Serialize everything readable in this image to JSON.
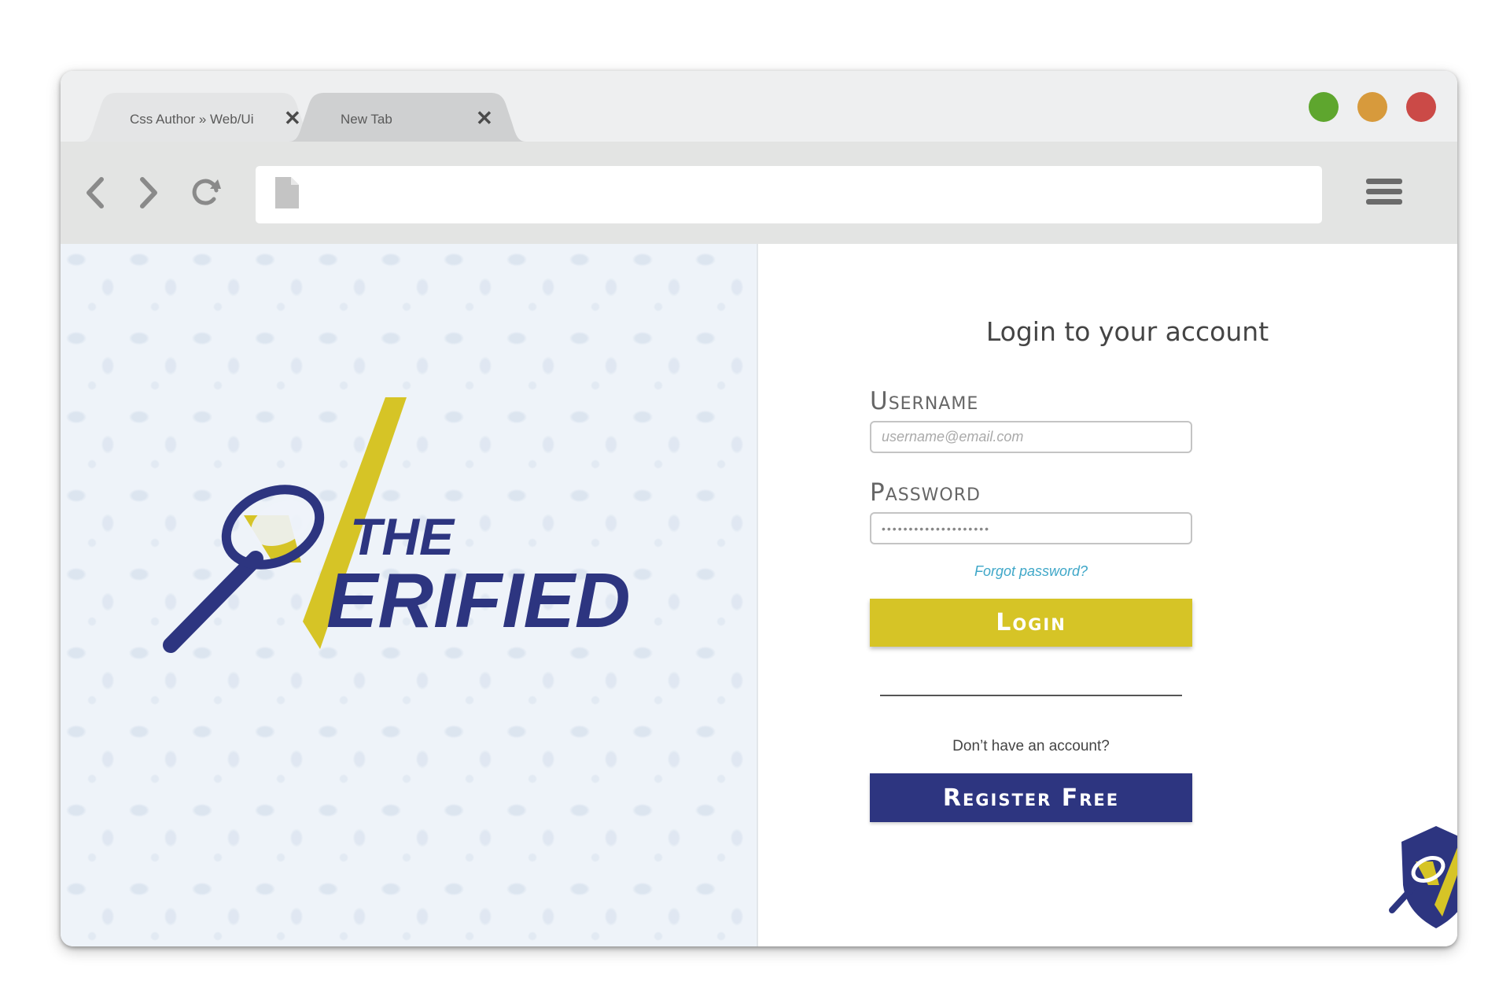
{
  "browser": {
    "tabs": [
      {
        "label": "Css Author » Web/Ui",
        "close": "✕"
      },
      {
        "label": "New Tab",
        "close": "✕"
      }
    ],
    "window_controls": [
      "green",
      "orange",
      "red"
    ],
    "address": {
      "url": ""
    },
    "icons": {
      "back": "chevron-left-icon",
      "forward": "chevron-right-icon",
      "reload": "reload-icon",
      "page": "page-icon",
      "menu": "hamburger-menu-icon"
    }
  },
  "logo": {
    "line1": "THE",
    "line2": "ERIFIED"
  },
  "login": {
    "title": "Login to your account",
    "username_label": "Username",
    "username_placeholder": "username@email.com",
    "password_label": "Password",
    "password_value": "••••••••••••••••••••",
    "forgot": "Forgot password?",
    "login_button": "Login",
    "no_account": "Don’t have an account?",
    "register_button": "Register Free"
  },
  "colors": {
    "brand_yellow": "#d6c426",
    "brand_navy": "#2d3580",
    "link": "#3fa7c8"
  }
}
